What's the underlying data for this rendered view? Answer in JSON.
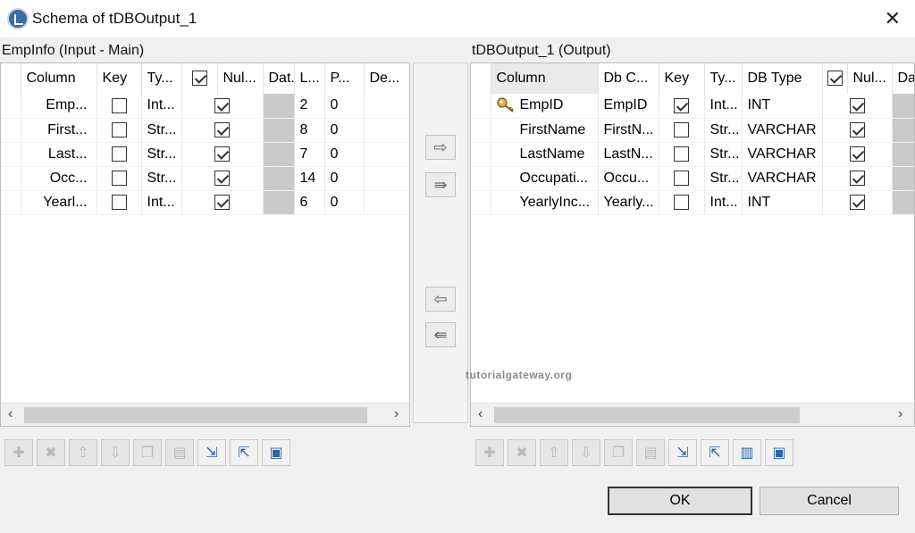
{
  "window": {
    "title": "Schema of tDBOutput_1"
  },
  "left_panel": {
    "label": "EmpInfo (Input - Main)",
    "columns": [
      "Column",
      "Key",
      "Ty...",
      "Nul...",
      "Dat...",
      "L...",
      "P...",
      "De...",
      "("
    ],
    "rows": [
      {
        "column": "Emp...",
        "key": false,
        "type": "Int...",
        "nullable": true,
        "length": "2",
        "precision": "0"
      },
      {
        "column": "First...",
        "key": false,
        "type": "Str...",
        "nullable": true,
        "length": "8",
        "precision": "0"
      },
      {
        "column": "Last...",
        "key": false,
        "type": "Str...",
        "nullable": true,
        "length": "7",
        "precision": "0"
      },
      {
        "column": "Occ...",
        "key": false,
        "type": "Str...",
        "nullable": true,
        "length": "14",
        "precision": "0"
      },
      {
        "column": "Yearl...",
        "key": false,
        "type": "Int...",
        "nullable": true,
        "length": "6",
        "precision": "0"
      }
    ]
  },
  "right_panel": {
    "label": "tDBOutput_1 (Output)",
    "columns": [
      "Column",
      "Db C...",
      "Key",
      "Ty...",
      "DB Type",
      "Nul...",
      "Da"
    ],
    "rows": [
      {
        "column": "EmpID",
        "db_column": "EmpID",
        "key": true,
        "type": "Int...",
        "db_type": "INT",
        "nullable": true
      },
      {
        "column": "FirstName",
        "db_column": "FirstN...",
        "key": false,
        "type": "Str...",
        "db_type": "VARCHAR",
        "nullable": true
      },
      {
        "column": "LastName",
        "db_column": "LastN...",
        "key": false,
        "type": "Str...",
        "db_type": "VARCHAR",
        "nullable": true
      },
      {
        "column": "Occupati...",
        "db_column": "Occu...",
        "key": false,
        "type": "Str...",
        "db_type": "VARCHAR",
        "nullable": true
      },
      {
        "column": "YearlyInc...",
        "db_column": "Yearly...",
        "key": false,
        "type": "Int...",
        "db_type": "INT",
        "nullable": true
      }
    ]
  },
  "transfer_buttons": {
    "copy_right": "⇨",
    "copy_all_right": "⇛",
    "copy_left": "⇦",
    "copy_all_left": "⇚"
  },
  "toolbar_icons": [
    "add-icon",
    "delete-icon",
    "move-up-icon",
    "move-down-icon",
    "copy-icon",
    "paste-icon",
    "import-icon",
    "export-icon",
    "save-icon"
  ],
  "watermark": "tutorialgateway.org",
  "buttons": {
    "ok": "OK",
    "cancel": "Cancel"
  },
  "colors": {
    "window_bg": "#f0f0f0",
    "table_bg": "#ffffff",
    "disabled_cell": "#c8c8c8",
    "accent": "#2a63b0"
  }
}
